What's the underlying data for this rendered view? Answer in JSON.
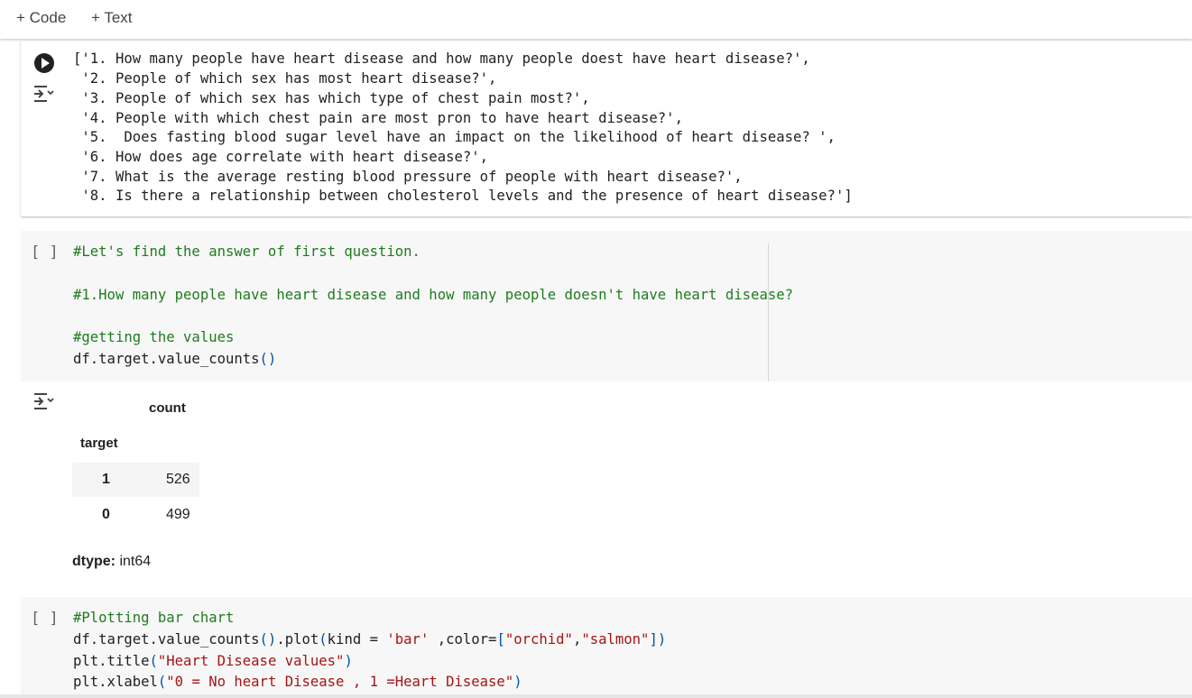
{
  "toolbar": {
    "add_code": "+ Code",
    "add_text": "+ Text"
  },
  "cell1": {
    "output_lines": [
      "['1. How many people have heart disease and how many people doest have heart disease?',",
      " '2. People of which sex has most heart disease?',",
      " '3. People of which sex has which type of chest pain most?',",
      " '4. People with which chest pain are most pron to have heart disease?',",
      " '5.  Does fasting blood sugar level have an impact on the likelihood of heart disease? ',",
      " '6. How does age correlate with heart disease?',",
      " '7. What is the average resting blood pressure of people with heart disease?',",
      " '8. Is there a relationship between cholesterol levels and the presence of heart disease?']"
    ]
  },
  "cell2": {
    "bracket": "[ ]",
    "line1": "#Let's find the answer of first question.",
    "line2": "#1.How many people have heart disease and how many people doesn't have heart disease?",
    "line3": "#getting the values",
    "line4_code": "df.target.value_counts",
    "line4_parens": "()"
  },
  "output2": {
    "count_header": "count",
    "index_header": "target",
    "rows": [
      {
        "label": "1",
        "value": "526"
      },
      {
        "label": "0",
        "value": "499"
      }
    ],
    "dtype_label": "dtype:",
    "dtype_value": " int64"
  },
  "cell3": {
    "bracket": "[ ]",
    "line1": "#Plotting bar chart",
    "line2": {
      "a": "df.target.value_counts",
      "b": "()",
      "c": ".plot",
      "d": "(",
      "e": "kind = ",
      "f": "'bar'",
      "g": " ,color=",
      "h": "[",
      "i": "\"orchid\"",
      "j": ",",
      "k": "\"salmon\"",
      "l": "]",
      "m": ")"
    },
    "line3": {
      "a": "plt.title",
      "b": "(",
      "c": "\"Heart Disease values\"",
      "d": ")"
    },
    "line4": {
      "a": "plt.xlabel",
      "b": "(",
      "c": "\"0 = No heart Disease , 1 =Heart Disease\"",
      "d": ")"
    }
  },
  "colors": {
    "comment": "#1e7c1e",
    "string": "#a31515",
    "paren": "#0451a5",
    "code_bg": "#f7f7f7"
  }
}
